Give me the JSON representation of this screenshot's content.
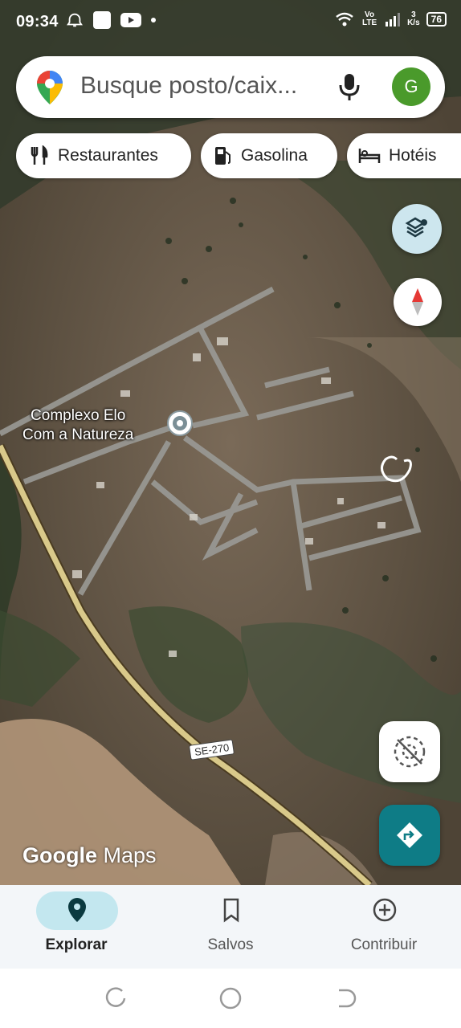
{
  "status_bar": {
    "time": "09:34",
    "network": "Vo LTE",
    "data_speed_top": "3",
    "data_speed_bottom": "K/s",
    "battery": "76"
  },
  "search": {
    "placeholder": "Busque posto/caix...",
    "avatar_letter": "G"
  },
  "chips": [
    {
      "label": "Restaurantes",
      "icon": "restaurant-icon"
    },
    {
      "label": "Gasolina",
      "icon": "gas-station-icon"
    },
    {
      "label": "Hotéis",
      "icon": "hotel-icon"
    }
  ],
  "map": {
    "place_label_line1": "Complexo Elo",
    "place_label_line2": "Com a Natureza",
    "road_label": "SE-270",
    "watermark_google": "Google",
    "watermark_maps": "Maps"
  },
  "bottom_nav": [
    {
      "label": "Explorar",
      "icon": "location-pin-icon",
      "active": true
    },
    {
      "label": "Salvos",
      "icon": "bookmark-icon",
      "active": false
    },
    {
      "label": "Contribuir",
      "icon": "add-circle-icon",
      "active": false
    }
  ],
  "colors": {
    "accent": "#0e7c86",
    "active_pill": "#c3e7ef",
    "avatar": "#4a9a2b",
    "road": "#d9c98a"
  }
}
